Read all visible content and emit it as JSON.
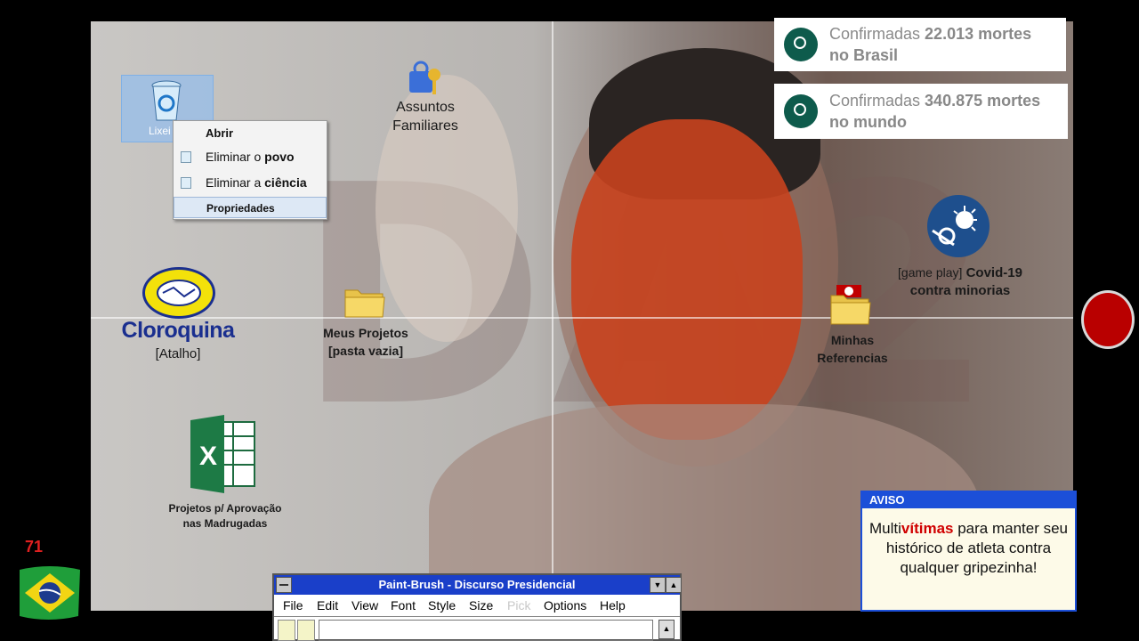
{
  "desktop": {
    "recycle_bin_label": "Lixei",
    "icons": {
      "assuntos": "Assuntos\nFamiliares",
      "cloroquina_logo": "Cloroquina",
      "cloroquina_sub": "[Atalho]",
      "meus_projetos": "Meus Projetos\n[pasta vazia]",
      "minhas_referencias": "Minhas\nReferencias",
      "covid_game_prefix": "[game play]",
      "covid_game_rest": " Covid-19",
      "covid_game_line2": "contra minorias",
      "excel": "Projetos p/ Aprovação\nnas Madrugadas"
    }
  },
  "context_menu": {
    "open": "Abrir",
    "item1_prefix": "Eliminar o ",
    "item1_bold": "povo",
    "item2_prefix": "Eliminar a ",
    "item2_bold": "ciência",
    "properties": "Propriedades"
  },
  "notifications": [
    {
      "prefix": "Confirmadas ",
      "count": "22.013 mortes",
      "suffix": "no Brasil"
    },
    {
      "prefix": "Confirmadas ",
      "count": "340.875 mortes",
      "suffix": "no mundo"
    }
  ],
  "aviso": {
    "title": "AVISO",
    "pre": "Multi",
    "highlight": "vítimas",
    "rest": " para manter seu histórico de atleta contra qualquer gripezinha!"
  },
  "paint": {
    "title": "Paint-Brush - Discurso Presidencial",
    "menu": [
      "File",
      "Edit",
      "View",
      "Font",
      "Style",
      "Size",
      "Pick",
      "Options",
      "Help"
    ]
  },
  "counter": "71",
  "colors": {
    "title_blue": "#1a3fc9",
    "notif_green": "#0e5b4c",
    "record_red": "#b90000",
    "alert_red": "#d00000"
  }
}
